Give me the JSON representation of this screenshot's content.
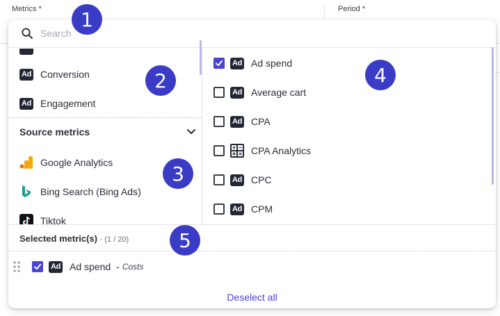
{
  "background": {
    "metrics_label": "Metrics *",
    "period_label": "Period *"
  },
  "search": {
    "placeholder": "Search",
    "icon": "search-icon"
  },
  "left_list": {
    "items": [
      {
        "label": "Conversion",
        "icon": "ad-icon",
        "badge": "Ad"
      },
      {
        "label": "Engagement",
        "icon": "ad-icon",
        "badge": "Ad"
      }
    ],
    "section": {
      "label": "Source metrics",
      "icon": "chevron-down-icon"
    },
    "sources": [
      {
        "label": "Google Analytics",
        "icon": "google-analytics-icon"
      },
      {
        "label": "Bing Search (Bing Ads)",
        "icon": "bing-icon"
      },
      {
        "label": "Tiktok",
        "icon": "tiktok-icon"
      }
    ]
  },
  "right_list": {
    "items": [
      {
        "label": "Ad spend",
        "checked": true,
        "icon": "ad-icon",
        "badge": "Ad"
      },
      {
        "label": "Average cart",
        "checked": false,
        "icon": "ad-icon",
        "badge": "Ad"
      },
      {
        "label": "CPA",
        "checked": false,
        "icon": "ad-icon",
        "badge": "Ad"
      },
      {
        "label": "CPA Analytics",
        "checked": false,
        "icon": "calculator-icon"
      },
      {
        "label": "CPC",
        "checked": false,
        "icon": "ad-icon",
        "badge": "Ad"
      },
      {
        "label": "CPM",
        "checked": false,
        "icon": "ad-icon",
        "badge": "Ad"
      }
    ]
  },
  "selected": {
    "title": "Selected metric(s)",
    "count": "- (1 / 20)",
    "items": [
      {
        "label": "Ad spend",
        "separator": "-",
        "category": "Costs",
        "checked": true,
        "badge": "Ad"
      }
    ],
    "deselect_all": "Deselect all"
  },
  "markers": [
    "1",
    "2",
    "3",
    "4",
    "5"
  ],
  "colors": {
    "accent": "#4a43d6",
    "marker": "#3b3cc6",
    "badge": "#232733"
  }
}
